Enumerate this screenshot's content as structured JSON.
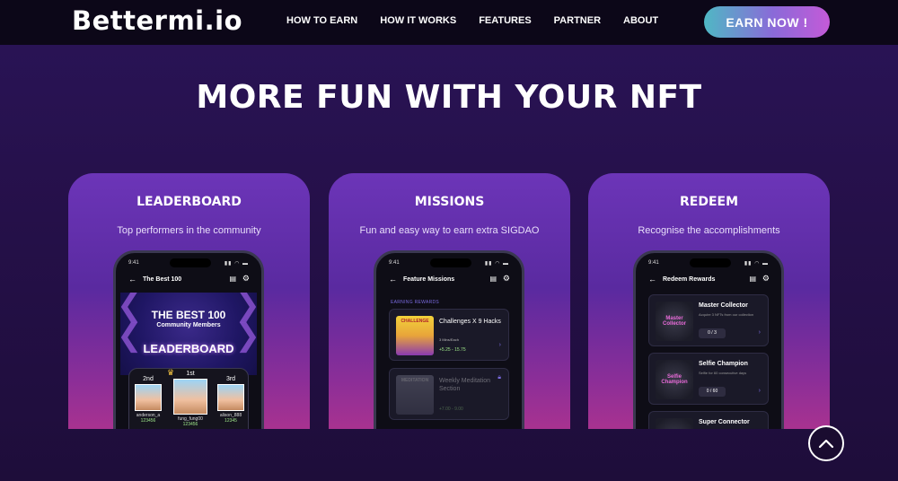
{
  "nav": {
    "logo": "Bettermi.io",
    "links": [
      "HOW TO EARN",
      "HOW IT WORKS",
      "FEATURES",
      "PARTNER",
      "ABOUT"
    ],
    "cta": "EARN NOW !"
  },
  "hero": {
    "title": "MORE FUN WITH YOUR NFT"
  },
  "cards": [
    {
      "title": "LEADERBOARD",
      "subtitle": "Top performers in the community",
      "phone": {
        "time": "9:41",
        "app_title": "The Best 100",
        "banner_big": "THE BEST 100",
        "banner_small": "Community Members",
        "banner_board": "LEADERBOARD",
        "podium": [
          {
            "rank": "2nd",
            "name": "anderson_a",
            "score": "123456"
          },
          {
            "rank": "1st",
            "name": "fung_fung00",
            "score": "123456"
          },
          {
            "rank": "3rd",
            "name": "alison_888",
            "score": "12345"
          }
        ]
      }
    },
    {
      "title": "MISSIONS",
      "subtitle": "Fun and easy way to earn extra SIGDAO",
      "phone": {
        "time": "9:41",
        "app_title": "Feature Missions",
        "section_label": "EARNING REWARDS",
        "missions": [
          {
            "thumb": "CHALLENGE",
            "title": "Challenges X 9 Hacks",
            "duration": "3 Mins/Each",
            "reward": "+5.25 - 15.75"
          },
          {
            "thumb": "MEDITATION",
            "title": "Weekly Meditation Section",
            "duration": "",
            "reward": "+7.00 - 9.00"
          }
        ]
      }
    },
    {
      "title": "REDEEM",
      "subtitle": "Recognise the accomplishments",
      "phone": {
        "time": "9:41",
        "app_title": "Redeem Rewards",
        "rewards": [
          {
            "thumb": "Master Collector",
            "title": "Master Collector",
            "desc": "Acquire 3 NFTs from our collection",
            "progress": "0 / 3"
          },
          {
            "thumb": "Selfie Champion",
            "title": "Selfie Champion",
            "desc": "Selfie for 60 consecutive days",
            "progress": "0 / 60"
          },
          {
            "thumb": "",
            "title": "Super Connector",
            "desc": "",
            "progress": ""
          }
        ]
      }
    }
  ],
  "icons": {
    "back": "arrow-left-icon",
    "chat": "chat-icon",
    "settings": "gear-icon",
    "scroll_top": "chevron-up-icon"
  }
}
